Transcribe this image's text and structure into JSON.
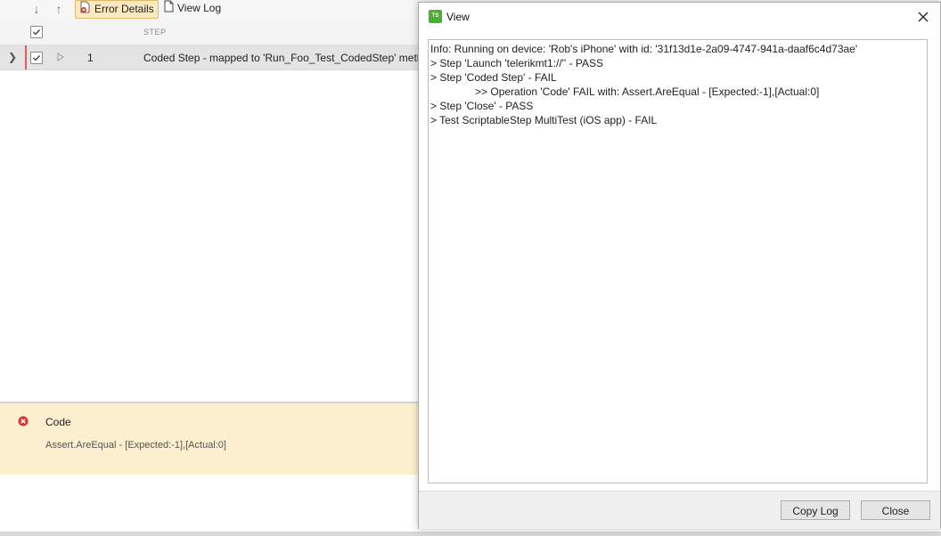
{
  "toolbar": {
    "move_down_icon": "arrow-down-icon",
    "move_up_icon": "arrow-up-icon",
    "error_details_label": "Error Details",
    "view_log_label": "View Log"
  },
  "grid": {
    "header": {
      "step_column": "STEP"
    },
    "rows": [
      {
        "number": "1",
        "description": "Coded Step - mapped to 'Run_Foo_Test_CodedStep' method."
      }
    ]
  },
  "error_panel": {
    "title": "Code",
    "message": "Assert.AreEqual - [Expected:-1],[Actual:0]",
    "accent": "#cc2a2a",
    "background": "#fcefcf"
  },
  "dialog": {
    "logo_text": "TS",
    "title": "View",
    "log_lines": [
      "Info: Running on device: 'Rob's iPhone' with id: '31f13d1e-2a09-4747-941a-daaf6c4d73ae'",
      "> Step 'Launch 'telerikmt1://'' - PASS",
      "> Step 'Coded Step' - FAIL",
      "               >> Operation 'Code' FAIL with: Assert.AreEqual - [Expected:-1],[Actual:0]",
      "> Step 'Close' - PASS",
      "> Test ScriptableStep MultiTest (iOS app) - FAIL"
    ],
    "copy_log_label": "Copy Log",
    "close_label": "Close",
    "brand_color": "#4caf30"
  }
}
